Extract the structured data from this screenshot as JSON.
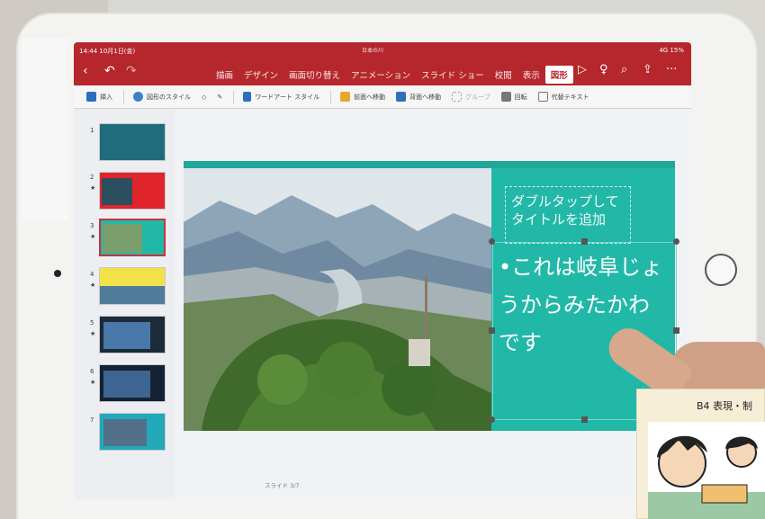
{
  "status": {
    "time": "14:44 10月1日(金)",
    "right": "4G 15%"
  },
  "document": {
    "title": "日本の川"
  },
  "ribbon": {
    "tabs": [
      "描画",
      "デザイン",
      "画面切り替え",
      "アニメーション",
      "スライド ショー",
      "校閲",
      "表示",
      "図形"
    ],
    "active_tab": "図形"
  },
  "toolbar": {
    "insert": "挿入",
    "shape_style": "図形のスタイル",
    "wordart_style": "ワードアート スタイル",
    "bring_forward": "前面へ移動",
    "send_backward": "背面へ移動",
    "group": "グループ",
    "rotate": "回転",
    "alt_text": "代替テキスト"
  },
  "thumbnails": [
    {
      "num": "1",
      "star": ""
    },
    {
      "num": "2",
      "star": "★"
    },
    {
      "num": "3",
      "star": "★"
    },
    {
      "num": "4",
      "star": "★"
    },
    {
      "num": "5",
      "star": "★"
    },
    {
      "num": "6",
      "star": "★"
    },
    {
      "num": "7",
      "star": ""
    }
  ],
  "selected_slide": 3,
  "slide": {
    "title_placeholder": "ダブルタップして タイトルを追加",
    "body_text": "•これは岐阜じょうからみたかわです",
    "accent_color": "#22b8a8"
  },
  "footer": {
    "slide_counter": "スライド 3/7"
  },
  "card": {
    "title": "B4 表現・制"
  },
  "colors": {
    "ribbon": "#b5272c",
    "selected": "#c8343a"
  }
}
